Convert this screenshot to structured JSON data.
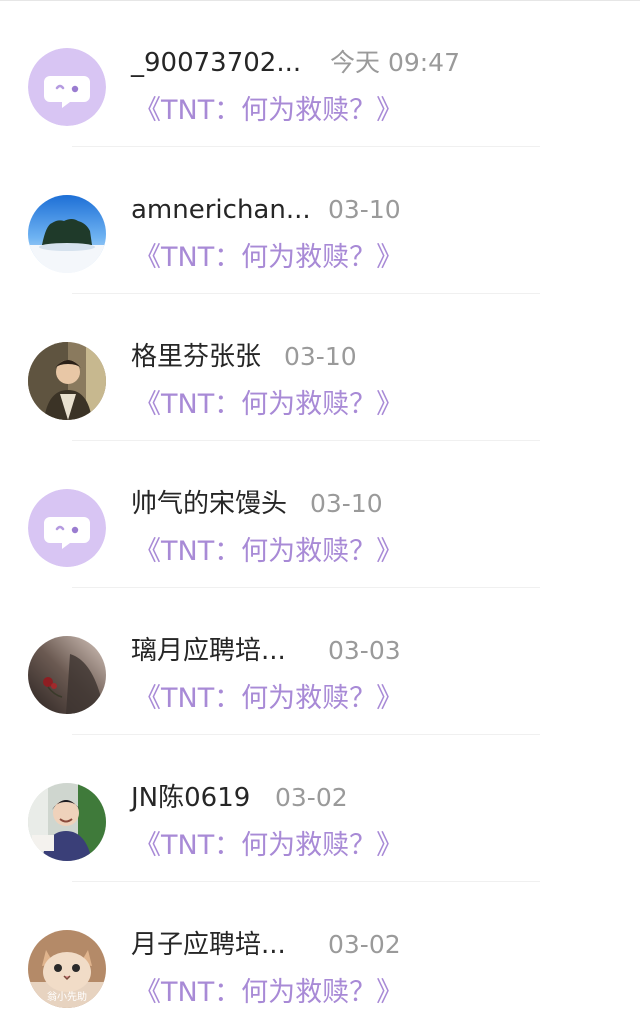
{
  "comments": [
    {
      "username": "_90073702...",
      "time": "今天 09:47",
      "post_title": "《TNT：何为救赎？》",
      "avatar": "default-chat-avatar-icon"
    },
    {
      "username": "amnerichan...",
      "time": "03-10",
      "post_title": "《TNT：何为救赎？》",
      "avatar": "snow-landscape-avatar"
    },
    {
      "username": "格里芬张张",
      "time": "03-10",
      "post_title": "《TNT：何为救赎？》",
      "avatar": "person-photo-avatar"
    },
    {
      "username": "帅气的宋馒头",
      "time": "03-10",
      "post_title": "《TNT：何为救赎？》",
      "avatar": "default-chat-avatar-icon"
    },
    {
      "username": "璃月应聘培...",
      "time": "03-03",
      "post_title": "《TNT：何为救赎？》",
      "avatar": "rose-photo-avatar"
    },
    {
      "username": "JN陈0619",
      "time": "03-02",
      "post_title": "《TNT：何为救赎？》",
      "avatar": "smiling-person-avatar"
    },
    {
      "username": "月子应聘培...",
      "time": "03-02",
      "post_title": "《TNT：何为救赎？》",
      "avatar": "cat-photo-avatar",
      "avatar_text": "翁小先助"
    }
  ],
  "colors": {
    "accent": "#a88ad6",
    "default_avatar_bg": "#d8c5f3",
    "name": "#262626",
    "time": "#9a9a9a"
  }
}
